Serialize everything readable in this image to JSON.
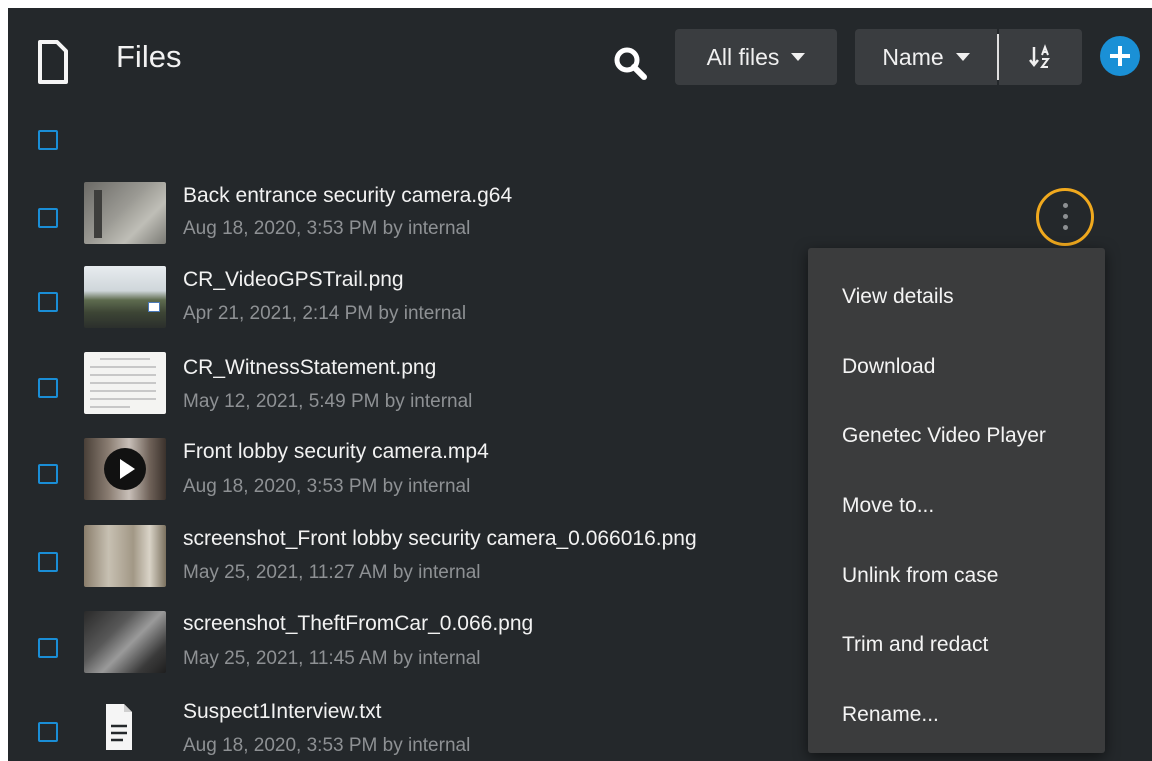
{
  "header": {
    "title": "Files",
    "filter_label": "All files",
    "sort_label": "Name",
    "icons": {
      "file": "file-outline-icon",
      "search": "search-icon",
      "sort_direction": "sort-ascending-icon",
      "add": "plus-icon"
    },
    "accent_color": "#1a90d6"
  },
  "files": [
    {
      "name": "Back entrance security camera.g64",
      "meta": "Aug 18, 2020, 3:53 PM by internal",
      "thumb": "camera-still"
    },
    {
      "name": "CR_VideoGPSTrail.png",
      "meta": "Apr 21, 2021, 2:14 PM by internal",
      "thumb": "road-image"
    },
    {
      "name": "CR_WitnessStatement.png",
      "meta": "May 12, 2021, 5:49 PM by internal",
      "thumb": "document-scan"
    },
    {
      "name": "Front lobby security camera.mp4",
      "meta": "Aug 18, 2020, 3:53 PM by internal",
      "thumb": "video-play"
    },
    {
      "name": "screenshot_Front lobby security camera_0.066016.png",
      "meta": "May 25, 2021, 11:27 AM by internal",
      "thumb": "crowd-image"
    },
    {
      "name": "screenshot_TheftFromCar_0.066.png",
      "meta": "May 25, 2021, 11:45 AM by internal",
      "thumb": "car-interior"
    },
    {
      "name": "Suspect1Interview.txt",
      "meta": "Aug 18, 2020, 3:53 PM by internal",
      "thumb": "text-file-icon"
    }
  ],
  "context_menu": {
    "items": [
      {
        "label": "View details"
      },
      {
        "label": "Download"
      },
      {
        "label": "Genetec Video Player"
      },
      {
        "label": "Move to..."
      },
      {
        "label": "Unlink from case"
      },
      {
        "label": "Trim and redact"
      },
      {
        "label": "Rename..."
      }
    ],
    "highlight_color": "#f0a91e"
  }
}
